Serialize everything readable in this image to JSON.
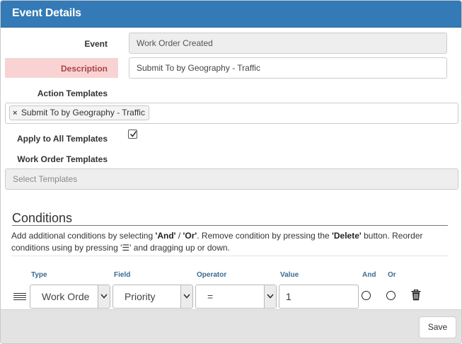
{
  "header": {
    "title": "Event Details"
  },
  "form": {
    "event": {
      "label": "Event",
      "value": "Work Order Created"
    },
    "description": {
      "label": "Description",
      "value": "Submit To by Geography - Traffic"
    },
    "action_templates": {
      "label": "Action Templates",
      "tags": [
        "Submit To by Geography - Traffic"
      ],
      "tag_remove_glyph": "×"
    },
    "apply_all": {
      "label": "Apply to All Templates",
      "checked": true
    },
    "work_order_templates": {
      "label": "Work Order Templates",
      "placeholder": "Select Templates"
    }
  },
  "conditions": {
    "title": "Conditions",
    "help_parts": {
      "p1": "Add additional conditions by selecting ",
      "and": "'And'",
      "p2": " / ",
      "or": "'Or'",
      "p3": ". Remove condition by pressing the ",
      "del": "'Delete'",
      "p4": " button. Reorder conditions using by pressing '",
      "handle": "☰",
      "p5": "' and dragging up or down."
    },
    "columns": {
      "type": "Type",
      "field": "Field",
      "operator": "Operator",
      "value": "Value",
      "and": "And",
      "or": "Or"
    },
    "row": {
      "type": "Work Orde",
      "field": "Priority",
      "operator": "=",
      "value": "1",
      "and_selected": false,
      "or_selected": false
    },
    "icons": {
      "drag": "drag-handle-icon",
      "delete": "trash-icon"
    }
  },
  "footer": {
    "save_label": "Save"
  },
  "colors": {
    "header": "#337ab7",
    "description_highlight": "#f9d3d3",
    "column_label": "#3a6a8f",
    "footer": "#e3e3e3"
  }
}
